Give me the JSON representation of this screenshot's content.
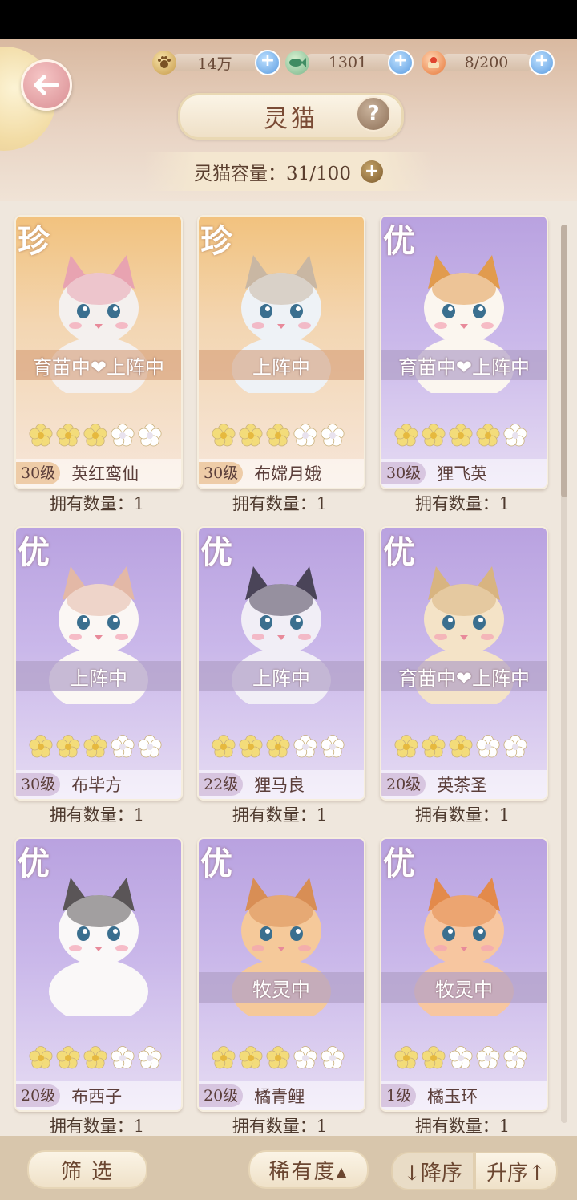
{
  "resources": [
    {
      "icon": "paw-coin-icon",
      "value": "14万"
    },
    {
      "icon": "jade-fish-icon",
      "value": "1301"
    },
    {
      "icon": "cake-icon",
      "value": "8/200"
    }
  ],
  "title": "灵猫",
  "capacity": {
    "label": "灵猫容量：31/100"
  },
  "cards": [
    {
      "rarity": "珍",
      "status": "育苗中❤上阵中",
      "stars": 3,
      "level": "30级",
      "name": "英红鸾仙",
      "own": "拥有数量：1"
    },
    {
      "rarity": "珍",
      "status": "上阵中",
      "stars": 3,
      "level": "30级",
      "name": "布嫦月娥",
      "own": "拥有数量：1"
    },
    {
      "rarity": "优",
      "status": "育苗中❤上阵中",
      "stars": 4,
      "level": "30级",
      "name": "狸飞英",
      "own": "拥有数量：1"
    },
    {
      "rarity": "优",
      "status": "上阵中",
      "stars": 3,
      "level": "30级",
      "name": "布毕方",
      "own": "拥有数量：1"
    },
    {
      "rarity": "优",
      "status": "上阵中",
      "stars": 3,
      "level": "22级",
      "name": "狸马良",
      "own": "拥有数量：1"
    },
    {
      "rarity": "优",
      "status": "育苗中❤上阵中",
      "stars": 3,
      "level": "20级",
      "name": "英茶圣",
      "own": "拥有数量：1"
    },
    {
      "rarity": "优",
      "status": "",
      "stars": 3,
      "level": "20级",
      "name": "布西子",
      "own": "拥有数量：1"
    },
    {
      "rarity": "优",
      "status": "牧灵中",
      "stars": 3,
      "level": "20级",
      "name": "橘青鲤",
      "own": "拥有数量：1"
    },
    {
      "rarity": "优",
      "status": "牧灵中",
      "stars": 2,
      "level": "1级",
      "name": "橘玉环",
      "own": "拥有数量：1"
    }
  ],
  "bottom": {
    "filter": "筛 选",
    "rarity_sort": "稀有度▴",
    "desc": "↓降序",
    "asc": "升序↑"
  },
  "colors": {
    "zhen_card": "#f2c27e",
    "you_card": "#b9a2e0",
    "star_on": "#f3dc7a",
    "star_off": "#ffffff"
  }
}
